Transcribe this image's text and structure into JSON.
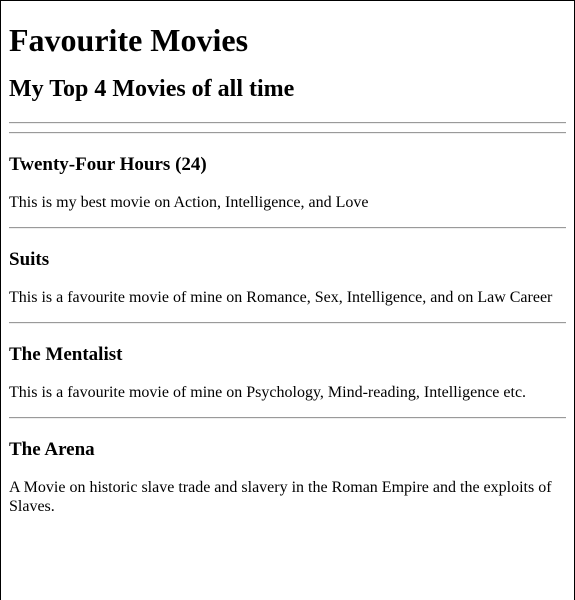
{
  "page": {
    "title": "Favourite Movies",
    "subtitle": "My Top 4 Movies of all time"
  },
  "movies": [
    {
      "title": "Twenty-Four Hours (24)",
      "description": "This is my best movie on Action, Intelligence, and Love"
    },
    {
      "title": "Suits",
      "description": "This is a favourite movie of mine on Romance, Sex, Intelligence, and on Law Career"
    },
    {
      "title": "The Mentalist",
      "description": "This is a favourite movie of mine on Psychology, Mind-reading, Intelligence etc."
    },
    {
      "title": "The Arena",
      "description": "A Movie on historic slave trade and slavery in the Roman Empire and the exploits of Slaves."
    }
  ]
}
